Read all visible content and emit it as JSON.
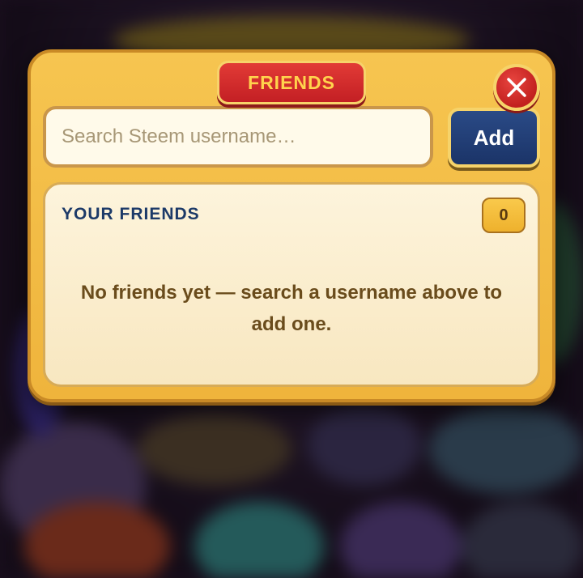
{
  "dialog": {
    "title": "FRIENDS",
    "close_icon": "close-icon"
  },
  "search": {
    "placeholder": "Search Steem username…",
    "value": "",
    "add_label": "Add"
  },
  "friends": {
    "heading": "YOUR FRIENDS",
    "count": "0",
    "empty_message": "No friends yet — search a username above to add one."
  },
  "colors": {
    "panel": "#f6c550",
    "title_tab": "#c31f24",
    "title_text": "#ffd34d",
    "add_button": "#1b3468",
    "heading_text": "#1c3a68",
    "badge": "#eeb12d"
  }
}
